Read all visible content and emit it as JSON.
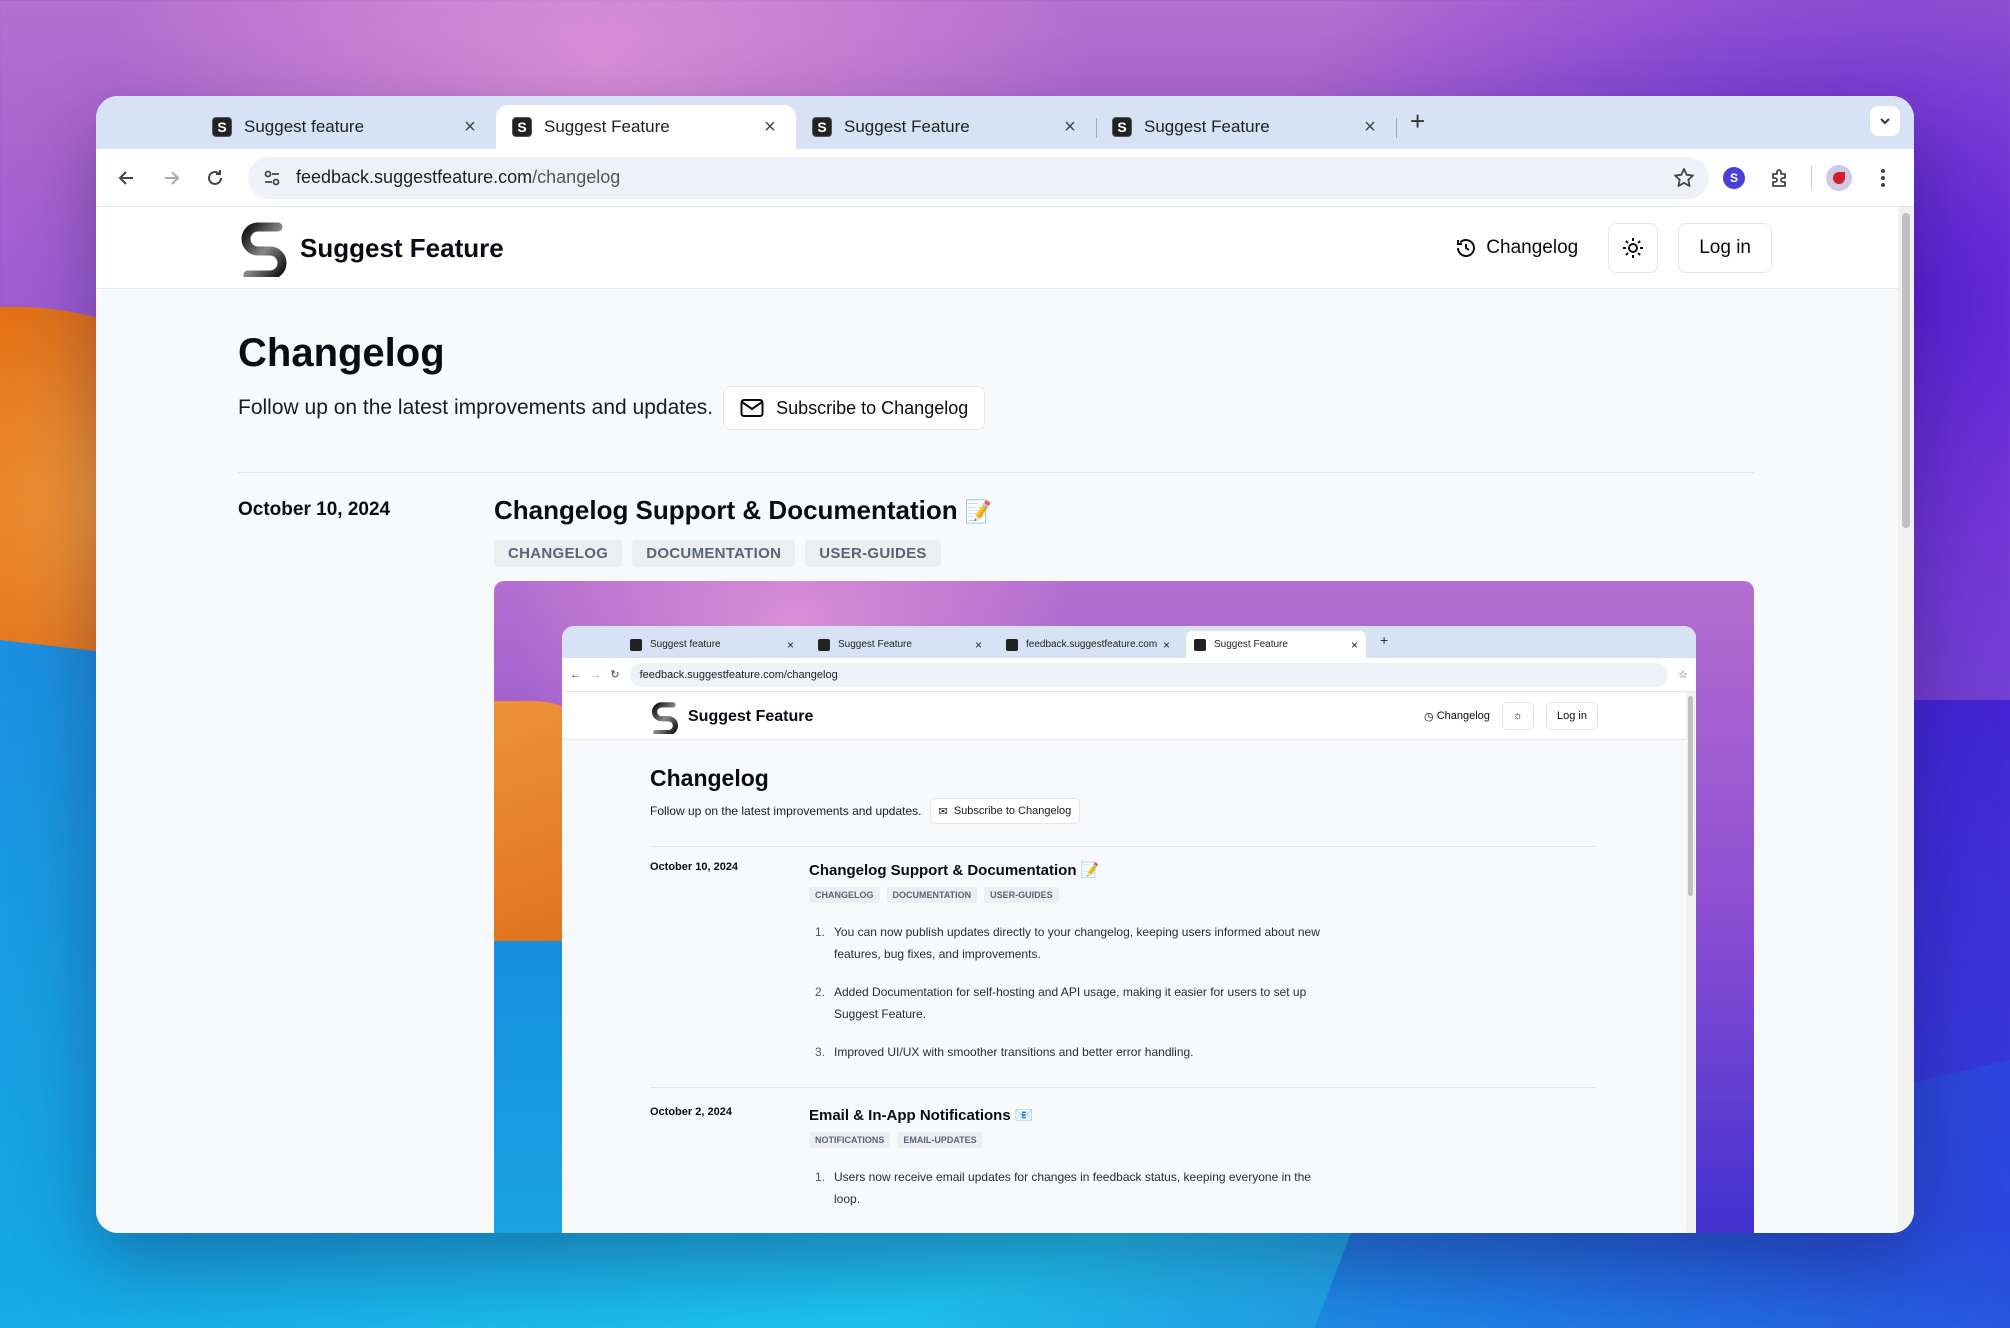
{
  "browser": {
    "tabs": [
      {
        "label": "Suggest feature",
        "active": false
      },
      {
        "label": "Suggest Feature",
        "active": true
      },
      {
        "label": "Suggest Feature",
        "active": false
      },
      {
        "label": "Suggest Feature",
        "active": false
      }
    ],
    "tab_close": "×",
    "new_tab": "+",
    "favicon_letter": "S",
    "url_host": "feedback.suggestfeature.com",
    "url_path": "/changelog",
    "extension_badge": "S"
  },
  "site": {
    "brand_name": "Suggest Feature",
    "nav_changelog": "Changelog",
    "login_label": "Log in"
  },
  "page": {
    "title": "Changelog",
    "subtitle": "Follow up on the latest improvements and updates.",
    "subscribe_label": "Subscribe to Changelog"
  },
  "entries": [
    {
      "date": "October 10, 2024",
      "title": "Changelog Support & Documentation",
      "emoji": "📝",
      "tags": [
        "CHANGELOG",
        "DOCUMENTATION",
        "USER-GUIDES"
      ]
    }
  ],
  "nested_screenshot": {
    "tabs": [
      {
        "label": "Suggest feature"
      },
      {
        "label": "Suggest Feature"
      },
      {
        "label": "feedback.suggestfeature.com"
      },
      {
        "label": "Suggest Feature"
      }
    ],
    "url": "feedback.suggestfeature.com/changelog",
    "brand_name": "Suggest Feature",
    "nav_changelog": "Changelog",
    "login_label": "Log in",
    "title": "Changelog",
    "subtitle": "Follow up on the latest improvements and updates.",
    "subscribe_label": "Subscribe to Changelog",
    "entries": [
      {
        "date": "October 10, 2024",
        "title": "Changelog Support & Documentation 📝",
        "tags": [
          "CHANGELOG",
          "DOCUMENTATION",
          "USER-GUIDES"
        ],
        "items": [
          "You can now publish updates directly to your changelog, keeping users informed about new features, bug fixes, and improvements.",
          "Added Documentation for self-hosting and API usage, making it easier for users to set up Suggest Feature.",
          "Improved UI/UX with smoother transitions and better error handling."
        ]
      },
      {
        "date": "October 2, 2024",
        "title": "Email & In-App Notifications 📧",
        "tags": [
          "NOTIFICATIONS",
          "EMAIL-UPDATES"
        ],
        "items": [
          "Users now receive email updates for changes in feedback status, keeping everyone in the loop."
        ]
      }
    ]
  },
  "colors": {
    "brand_text": "#0b0b14",
    "tag_bg": "#eceef2",
    "tag_text": "#5b6476",
    "tabbar_bg": "#d7e2f4"
  }
}
